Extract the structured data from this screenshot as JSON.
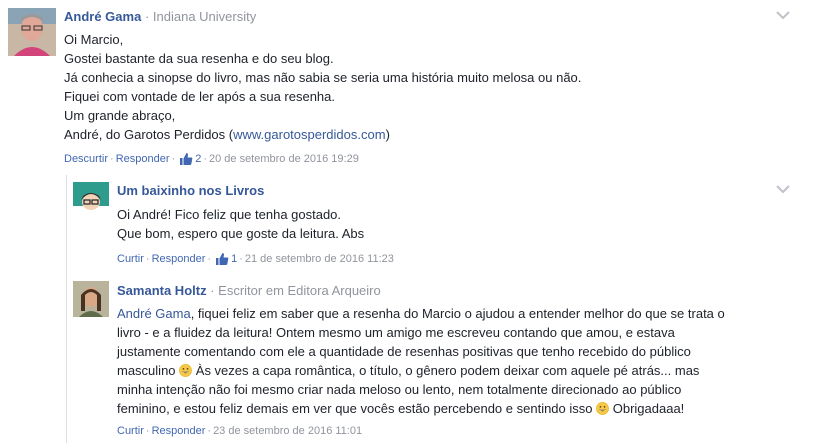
{
  "comments": [
    {
      "author": "André Gama",
      "affiliation": "Indiana University",
      "lines": [
        "Oi Marcio,",
        "Gostei bastante da sua resenha e do seu blog.",
        "Já conhecia a sinopse do livro, mas não sabia se seria uma história muito melosa ou não.",
        "Fiquei com vontade de ler após a sua resenha.",
        "Um grande abraço,"
      ],
      "last_line_prefix": "André, do Garotos Perdidos (",
      "last_line_link": "www.garotosperdidos.com",
      "last_line_suffix": ")",
      "actions": {
        "unlike": "Descurtir",
        "reply": "Responder",
        "likes": "2",
        "time": "20 de setembro de 2016 19:29"
      }
    },
    {
      "author": "Um baixinho nos Livros",
      "lines": [
        "Oi André! Fico feliz que tenha gostado.",
        "Que bom, espero que goste da leitura. Abs"
      ],
      "actions": {
        "like": "Curtir",
        "reply": "Responder",
        "likes": "1",
        "time": "21 de setembro de 2016 11:23"
      }
    },
    {
      "author": "Samanta Holtz",
      "affiliation": "Escritor em Editora Arqueiro",
      "mention": "André Gama",
      "line1_rest": ", fiquei feliz em saber que a resenha do Marcio o ajudou a entender melhor do que se trata o",
      "line2": "livro - e a fluidez da leitura! Ontem mesmo um amigo me escreveu contando que amou, e estava",
      "line3": "justamente comentando com ele a quantidade de resenhas positivas que tenho recebido do público",
      "line4_a": "masculino",
      "line4_b": " Às vezes a capa romântica, o título, o gênero podem deixar com aquele pé atrás... mas",
      "line5": "minha intenção não foi mesmo criar nada meloso ou lento, nem totalmente direcionado ao público",
      "line6_a": "feminino, e estou feliz demais em ver que vocês estão percebendo e sentindo isso",
      "line6_b": " Obrigadaaa!",
      "actions": {
        "like": "Curtir",
        "reply": "Responder",
        "time": "23 de setembro de 2016 11:01"
      }
    }
  ],
  "separator": "·",
  "icons": {
    "chevron": "chevron-down-icon",
    "like": "thumbs-up-icon",
    "emoji": "grinning-face-icon"
  },
  "colors": {
    "link": "#365899",
    "meta": "#90949c",
    "action": "#4267b2"
  }
}
